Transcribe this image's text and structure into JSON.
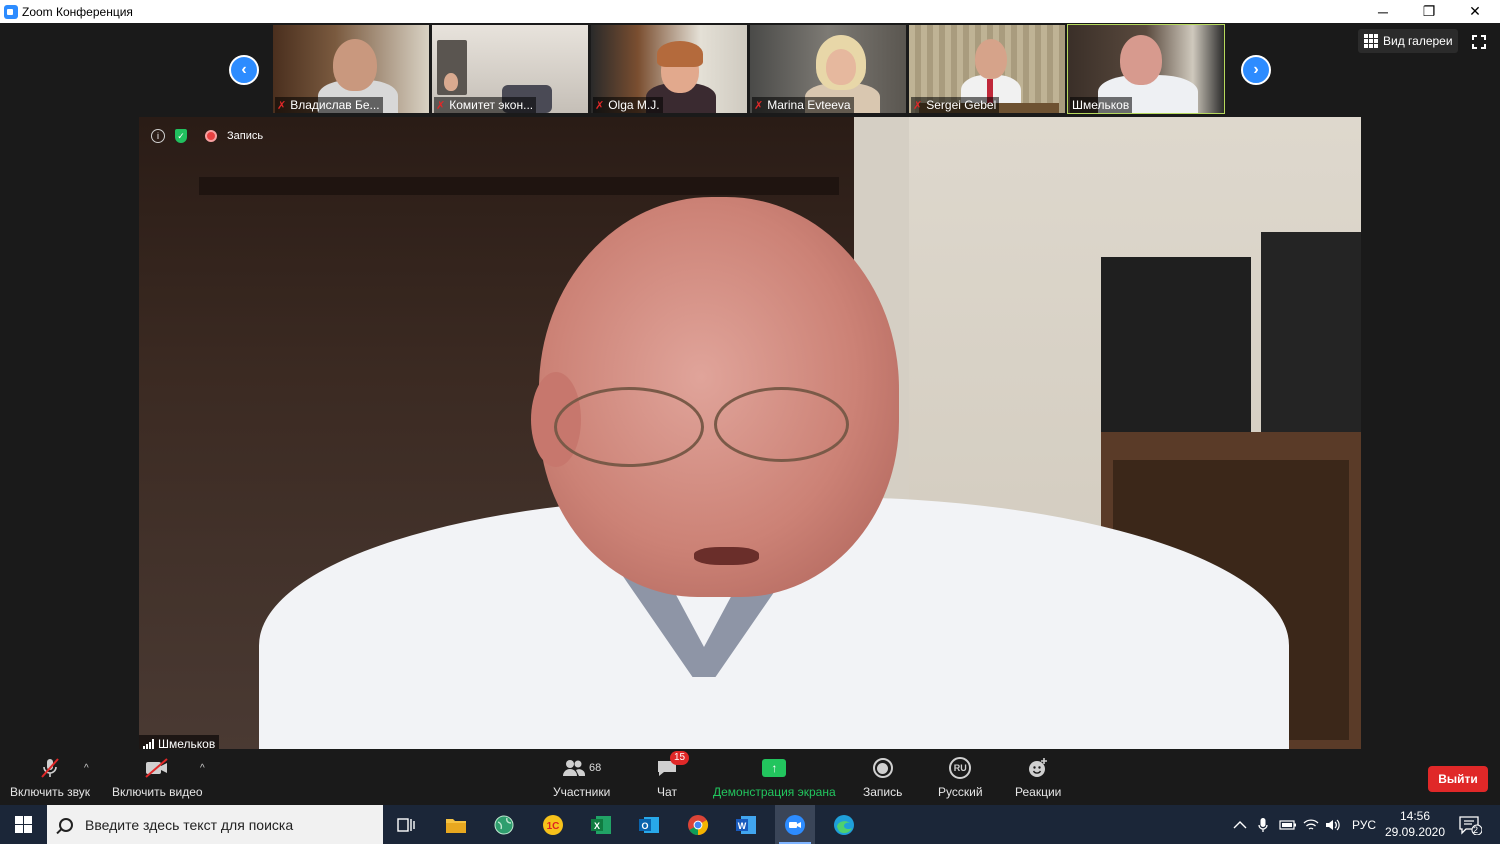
{
  "window": {
    "title": "Zoom Конференция",
    "minimize_glyph": "─",
    "restore_glyph": "❐",
    "close_glyph": "✕"
  },
  "thumbnails": [
    {
      "name": "Владислав Бе...",
      "muted": true,
      "bg": "#6a4a2f",
      "active": false
    },
    {
      "name": "Комитет экон...",
      "muted": true,
      "bg": "#c9c3bb",
      "active": false
    },
    {
      "name": "Olga M.J.",
      "muted": true,
      "bg": "#5e4a3a",
      "active": false
    },
    {
      "name": "Marina Evteeva",
      "muted": true,
      "bg": "#6c6a66",
      "active": false
    },
    {
      "name": "Sergei Gebel",
      "muted": true,
      "bg": "#8a7d66",
      "active": false
    },
    {
      "name": "Шмельков",
      "muted": false,
      "bg": "#4f473d",
      "active": true
    }
  ],
  "nav": {
    "prev_glyph": "‹",
    "next_glyph": "›"
  },
  "gallery_view": {
    "label": "Вид галереи"
  },
  "speaker": {
    "name": "Шмельков",
    "recording_label": "Запись",
    "info_glyph": "i",
    "shield_glyph": "✓"
  },
  "controls": {
    "audio": {
      "label": "Включить звук",
      "icon": "mic-muted-icon"
    },
    "video": {
      "label": "Включить видео",
      "icon": "camera-off-icon"
    },
    "participants": {
      "label": "Участники",
      "count": "68"
    },
    "chat": {
      "label": "Чат",
      "badge": "15"
    },
    "share": {
      "label": "Демонстрация экрана",
      "color": "#22c55e"
    },
    "record": {
      "label": "Запись"
    },
    "language": {
      "label": "Русский",
      "code": "RU"
    },
    "reactions": {
      "label": "Реакции"
    },
    "leave": {
      "label": "Выйти",
      "color": "#e02828"
    }
  },
  "taskbar": {
    "search_placeholder": "Введите здесь текст для поиска",
    "language": "РУС",
    "time": "14:56",
    "date": "29.09.2020",
    "notifications": "2"
  },
  "colors": {
    "accent": "#2d8cff",
    "active_border": "#b6d95c",
    "muted_mic": "#e02828"
  }
}
